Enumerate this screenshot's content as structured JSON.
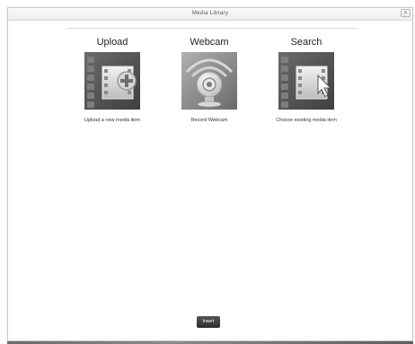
{
  "window": {
    "title": "Media Library",
    "close_glyph": "×"
  },
  "options": [
    {
      "heading": "Upload",
      "caption": "Upload a new media item",
      "icon": "film-add-icon"
    },
    {
      "heading": "Webcam",
      "caption": "Record Webcam",
      "icon": "webcam-icon"
    },
    {
      "heading": "Search",
      "caption": "Choose existing media item",
      "icon": "film-cursor-icon"
    }
  ],
  "footer": {
    "insert_label": "Insert"
  },
  "colors": {
    "thumb_dark": "#5c5c5c",
    "thumb_light": "#8d8d8d",
    "button_bg": "#333333"
  }
}
